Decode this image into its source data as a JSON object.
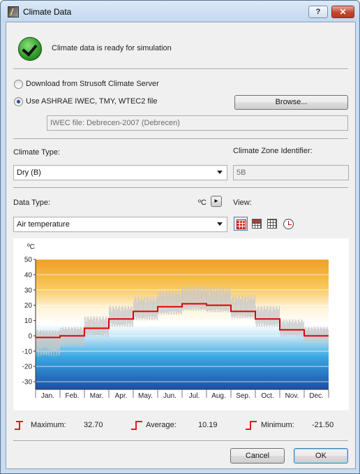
{
  "window": {
    "title": "Climate Data",
    "help_label": "?",
    "close_label": "✕"
  },
  "status": {
    "message": "Climate data is ready for simulation",
    "icon": "checkmark-icon"
  },
  "source": {
    "option_server": "Download from Strusoft Climate Server",
    "option_file": "Use ASHRAE IWEC, TMY, WTEC2 file",
    "selected": "file",
    "browse_label": "Browse...",
    "file_info": "IWEC file: Debrecen-2007 (Debrecen)"
  },
  "climate": {
    "type_label": "Climate Type:",
    "type_value": "Dry (B)",
    "zone_label": "Climate Zone Identifier:",
    "zone_value": "5B"
  },
  "data_type": {
    "label": "Data Type:",
    "unit": "ºC",
    "unit_button": "▸",
    "value": "Air temperature",
    "view_label": "View:"
  },
  "chart_data": {
    "type": "line",
    "ylabel": "ºC",
    "ylim": [
      -35,
      50
    ],
    "yticks": [
      50,
      40,
      30,
      20,
      10,
      0,
      -10,
      -20,
      -30
    ],
    "categories": [
      "Jan.",
      "Feb.",
      "Mar.",
      "Apr.",
      "May.",
      "Jun.",
      "Jul.",
      "Aug.",
      "Sep.",
      "Oct.",
      "Nov.",
      "Dec."
    ],
    "series": [
      {
        "values": [
          -1,
          0,
          5,
          11,
          16,
          19,
          21,
          20,
          16,
          11,
          4,
          0
        ],
        "color": "#e00000"
      }
    ],
    "daily_range": {
      "color": "#c8c8c8",
      "max": [
        4,
        6,
        13,
        20,
        26,
        30,
        33,
        32,
        27,
        20,
        11,
        6
      ],
      "min": [
        -21.5,
        -12,
        -5,
        2,
        6,
        10,
        13,
        12,
        8,
        2,
        -4,
        -8
      ]
    },
    "grid": true
  },
  "stats": {
    "max_label": "Maximum:",
    "max_value": "32.70",
    "avg_label": "Average:",
    "avg_value": "10.19",
    "min_label": "Minimum:",
    "min_value": "-21.50"
  },
  "footer": {
    "cancel_label": "Cancel",
    "ok_label": "OK"
  }
}
